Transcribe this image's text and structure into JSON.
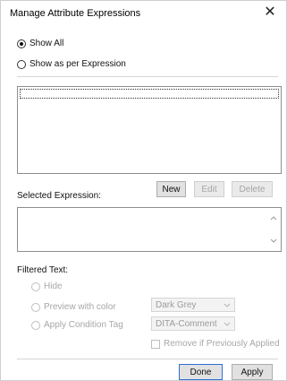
{
  "window": {
    "title": "Manage Attribute Expressions",
    "close_glyph": "✕"
  },
  "filter_mode": {
    "options": [
      {
        "label": "Show All",
        "selected": true
      },
      {
        "label": "Show as per Expression",
        "selected": false
      }
    ]
  },
  "expressions_list": {
    "items": []
  },
  "list_buttons": {
    "new": "New",
    "edit": "Edit",
    "delete": "Delete"
  },
  "selected_expression": {
    "label": "Selected Expression:",
    "value": ""
  },
  "filtered_text": {
    "label": "Filtered Text:",
    "options": [
      {
        "label": "Hide"
      },
      {
        "label": "Preview with color"
      },
      {
        "label": "Apply Condition Tag"
      }
    ],
    "color_select": {
      "value": "Dark Grey"
    },
    "tag_select": {
      "value": "DITA-Comment"
    },
    "remove_checkbox": {
      "label": "Remove if Previously Applied",
      "checked": false
    }
  },
  "footer": {
    "done": "Done",
    "apply": "Apply"
  },
  "icons": [
    "close-icon",
    "scroll-up-icon",
    "scroll-down-icon",
    "chevron-down-icon"
  ],
  "colors": {
    "primary_border": "#2e6fd6",
    "disabled_text": "#a7a7a7"
  }
}
